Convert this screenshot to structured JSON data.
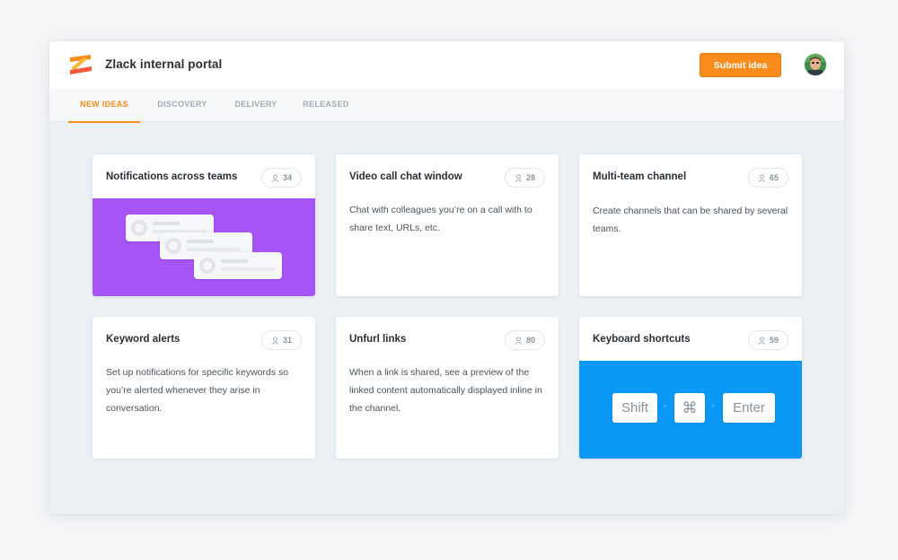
{
  "header": {
    "app_title": "Zlack internal portal",
    "submit_label": "Submit idea"
  },
  "tabs": [
    {
      "label": "NEW IDEAS",
      "active": true
    },
    {
      "label": "DISCOVERY",
      "active": false
    },
    {
      "label": "DELIVERY",
      "active": false
    },
    {
      "label": "RELEASED",
      "active": false
    }
  ],
  "cards": [
    {
      "title": "Notifications across teams",
      "votes": "34",
      "media": "notifications-illustration"
    },
    {
      "title": "Video call chat window",
      "votes": "28",
      "description": "Chat with colleagues you’re on a call with to share text, URLs, etc."
    },
    {
      "title": "Multi-team channel",
      "votes": "65",
      "description": "Create channels that can be shared by several teams."
    },
    {
      "title": "Keyword alerts",
      "votes": "31",
      "description": "Set up notifications for specific keywords so you’re alerted whenever they arise in conversation."
    },
    {
      "title": "Unfurl links",
      "votes": "80",
      "description": "When a link is shared, see a preview of the linked content automatically displayed inline in the channel."
    },
    {
      "title": "Keyboard shortcuts",
      "votes": "59",
      "media": "keyboard-shortcut-illustration",
      "keys": [
        "Shift",
        "⌘",
        "Enter"
      ],
      "key_separator": "+"
    }
  ],
  "colors": {
    "accent": "#fb8c1c",
    "purple_media": "#a855f7",
    "blue_media": "#0a98f7"
  },
  "icons": {
    "logo": "zlack-logo",
    "vote": "user-icon",
    "avatar": "user-avatar"
  }
}
